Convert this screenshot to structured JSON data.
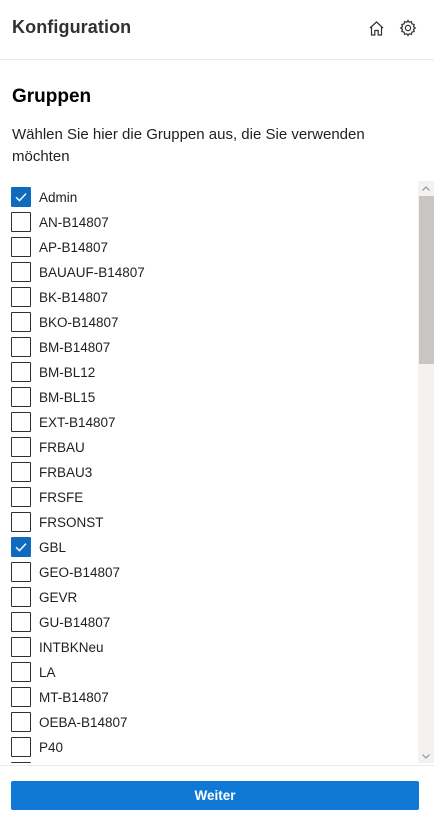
{
  "header": {
    "title": "Konfiguration",
    "icons": [
      "home-icon",
      "gear-icon"
    ]
  },
  "section": {
    "title": "Gruppen",
    "description": "Wählen Sie hier die Gruppen aus, die Sie verwenden möchten"
  },
  "groups": [
    {
      "label": "Admin",
      "checked": true
    },
    {
      "label": "AN-B14807",
      "checked": false
    },
    {
      "label": "AP-B14807",
      "checked": false
    },
    {
      "label": "BAUAUF-B14807",
      "checked": false
    },
    {
      "label": "BK-B14807",
      "checked": false
    },
    {
      "label": "BKO-B14807",
      "checked": false
    },
    {
      "label": "BM-B14807",
      "checked": false
    },
    {
      "label": "BM-BL12",
      "checked": false
    },
    {
      "label": "BM-BL15",
      "checked": false
    },
    {
      "label": "EXT-B14807",
      "checked": false
    },
    {
      "label": "FRBAU",
      "checked": false
    },
    {
      "label": "FRBAU3",
      "checked": false
    },
    {
      "label": "FRSFE",
      "checked": false
    },
    {
      "label": "FRSONST",
      "checked": false
    },
    {
      "label": "GBL",
      "checked": true
    },
    {
      "label": "GEO-B14807",
      "checked": false
    },
    {
      "label": "GEVR",
      "checked": false
    },
    {
      "label": "GU-B14807",
      "checked": false
    },
    {
      "label": "INTBKNeu",
      "checked": false
    },
    {
      "label": "LA",
      "checked": false
    },
    {
      "label": "MT-B14807",
      "checked": false
    },
    {
      "label": "OEBA-B14807",
      "checked": false
    },
    {
      "label": "P40",
      "checked": false
    },
    {
      "label": "",
      "checked": false
    }
  ],
  "footer": {
    "next_label": "Weiter"
  },
  "colors": {
    "accent": "#0f6cbd",
    "button": "#0f78d4"
  }
}
